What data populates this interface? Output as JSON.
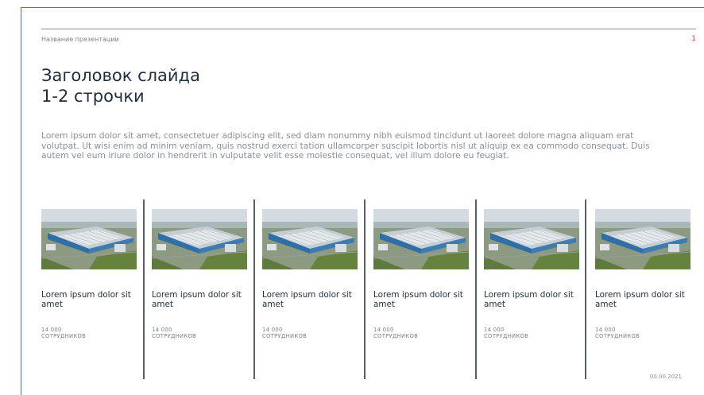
{
  "header": {
    "presentation_name": "Название презентации",
    "page_number": "1"
  },
  "title": {
    "line1": "Заголовок слайда",
    "line2": "1-2 строчки"
  },
  "body_text": "Lorem ipsum dolor sit amet, consectetuer adipiscing elit, sed diam nonummy nibh euismod tincidunt ut laoreet dolore magna aliquam erat volutpat. Ut wisi enim ad minim veniam, quis nostrud exerci tation ullamcorper suscipit lobortis nisl ut aliquip ex ea commodo consequat. Duis autem vel eum iriure dolor in hendrerit in vulputate velit esse molestie consequat, vel illum dolore eu feugiat.",
  "cards": [
    {
      "title": "Lorem ipsum dolor sit amet",
      "stat_value": "14 000",
      "stat_label": "СОТРУДНИКОВ"
    },
    {
      "title": "Lorem ipsum dolor sit amet",
      "stat_value": "14 000",
      "stat_label": "СОТРУДНИКОВ"
    },
    {
      "title": "Lorem ipsum dolor sit amet",
      "stat_value": "14 000",
      "stat_label": "СОТРУДНИКОВ"
    },
    {
      "title": "Lorem ipsum dolor sit amet",
      "stat_value": "14 000",
      "stat_label": "СОТРУДНИКОВ"
    },
    {
      "title": "Lorem ipsum dolor sit amet",
      "stat_value": "14 000",
      "stat_label": "СОТРУДНИКОВ"
    },
    {
      "title": "Lorem ipsum dolor sit amet",
      "stat_value": "14 000",
      "stat_label": "СОТРУДНИКОВ"
    }
  ],
  "footer": {
    "date": "00.00.2021"
  },
  "colors": {
    "frame": "#3a7bc8",
    "page_number": "#e0312b",
    "divider": "#5a5f66",
    "title": "#1f2d3d",
    "muted_text": "#8a8f96"
  },
  "icons": {
    "card_image": "factory-aerial-photo"
  }
}
